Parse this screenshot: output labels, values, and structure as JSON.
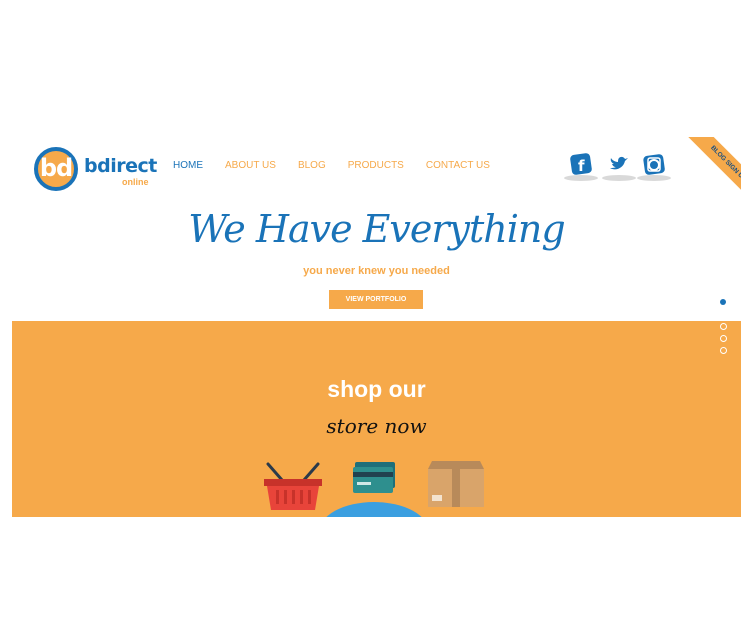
{
  "logo": {
    "mark": "bd",
    "name": "bdirect",
    "sub": "online"
  },
  "nav": {
    "items": [
      {
        "label": "HOME",
        "active": true
      },
      {
        "label": "ABOUT US",
        "active": false
      },
      {
        "label": "BLOG",
        "active": false
      },
      {
        "label": "PRODUCTS",
        "active": false
      },
      {
        "label": "CONTACT US",
        "active": false
      }
    ]
  },
  "social": {
    "icons": [
      "facebook-icon",
      "twitter-icon",
      "instagram-icon"
    ]
  },
  "ribbon": {
    "label": "BLOG SIGN UP"
  },
  "hero": {
    "title": "We Have Everything",
    "subtitle": "you never knew you needed",
    "button": "VIEW PORTFOLIO"
  },
  "shop": {
    "title": "shop our",
    "script": "store now",
    "icons": [
      "basket-icon",
      "credit-card-icon",
      "box-icon"
    ]
  },
  "colors": {
    "brand_blue": "#1a73b8",
    "brand_orange": "#f6a94a"
  }
}
